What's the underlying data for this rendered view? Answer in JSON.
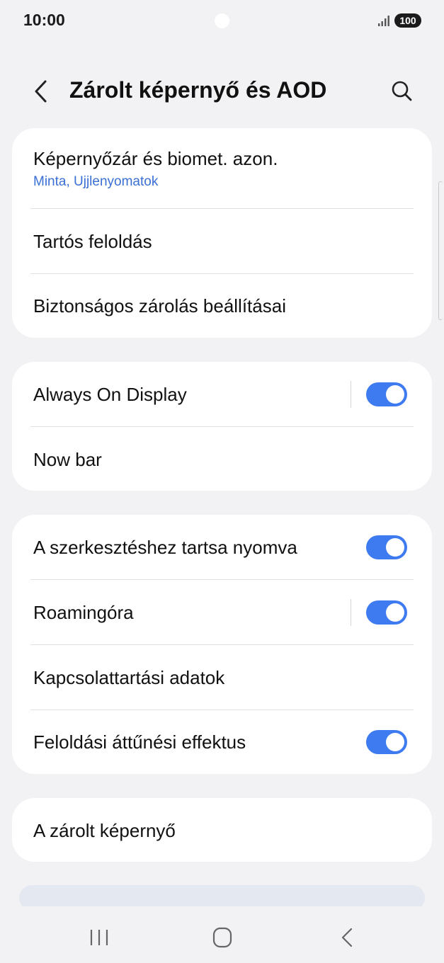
{
  "status_bar": {
    "time": "10:00",
    "battery": "100",
    "icons": [
      "signal-icon",
      "battery-icon",
      "camera-cutout"
    ]
  },
  "header": {
    "title": "Zárolt képernyő és AOD",
    "back_icon": "chevron-left-icon",
    "search_icon": "search-icon"
  },
  "sections": [
    {
      "items": [
        {
          "label": "Képernyőzár és biomet. azon.",
          "sublabel": "Minta, Ujjlenyomatok"
        },
        {
          "label": "Tartós feloldás"
        },
        {
          "label": "Biztonságos zárolás beállításai"
        }
      ]
    },
    {
      "items": [
        {
          "label": "Always On Display",
          "toggle": true
        },
        {
          "label": "Now bar"
        }
      ]
    },
    {
      "items": [
        {
          "label": "A szerkesztéshez tartsa nyomva",
          "toggle": true
        },
        {
          "label": "Roamingóra",
          "toggle": true
        },
        {
          "label": "Kapcsolattartási adatok"
        },
        {
          "label": "Feloldási áttűnési effektus",
          "toggle": true
        }
      ]
    },
    {
      "items": [
        {
          "label": "A zárolt képernyő"
        }
      ]
    }
  ],
  "nav_bar": {
    "icons": [
      "recent-apps-icon",
      "home-icon",
      "back-icon"
    ]
  },
  "colors": {
    "accent": "#3e7bf0",
    "sublabel": "#3a6fd4",
    "background": "#f2f2f4",
    "card": "#ffffff"
  }
}
